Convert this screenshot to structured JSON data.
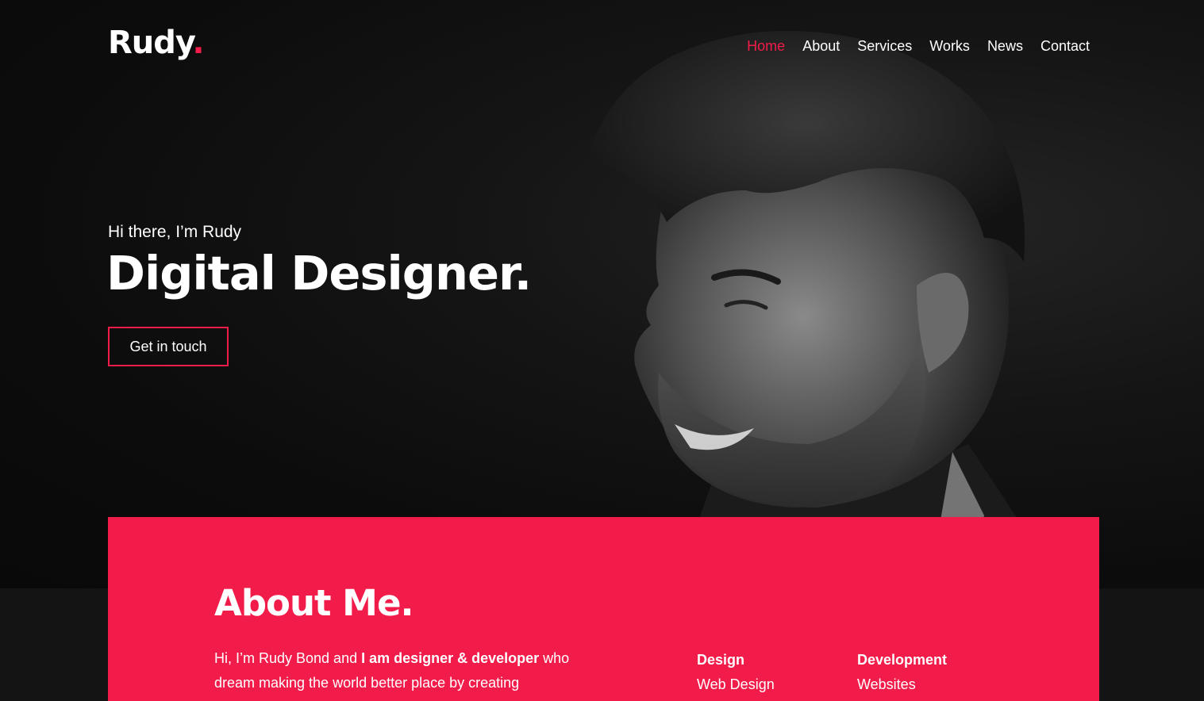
{
  "brand": {
    "name": "Rudy",
    "dot": "."
  },
  "nav": {
    "items": [
      {
        "label": "Home",
        "active": true
      },
      {
        "label": "About"
      },
      {
        "label": "Services"
      },
      {
        "label": "Works"
      },
      {
        "label": "News"
      },
      {
        "label": "Contact"
      }
    ]
  },
  "hero": {
    "greeting": "Hi there, I’m Rudy",
    "headline": "Digital Designer.",
    "cta_label": "Get in touch"
  },
  "about": {
    "title": "About Me.",
    "intro_prefix": "Hi, I’m Rudy Bond and ",
    "intro_bold": "I am designer & developer",
    "intro_suffix": " who dream making the world better place by creating",
    "columns": [
      {
        "heading": "Design",
        "items": [
          "Web Design"
        ]
      },
      {
        "heading": "Development",
        "items": [
          "Websites"
        ]
      }
    ]
  },
  "colors": {
    "accent": "#f21c4a",
    "background": "#0b0b0b",
    "text": "#ffffff"
  }
}
